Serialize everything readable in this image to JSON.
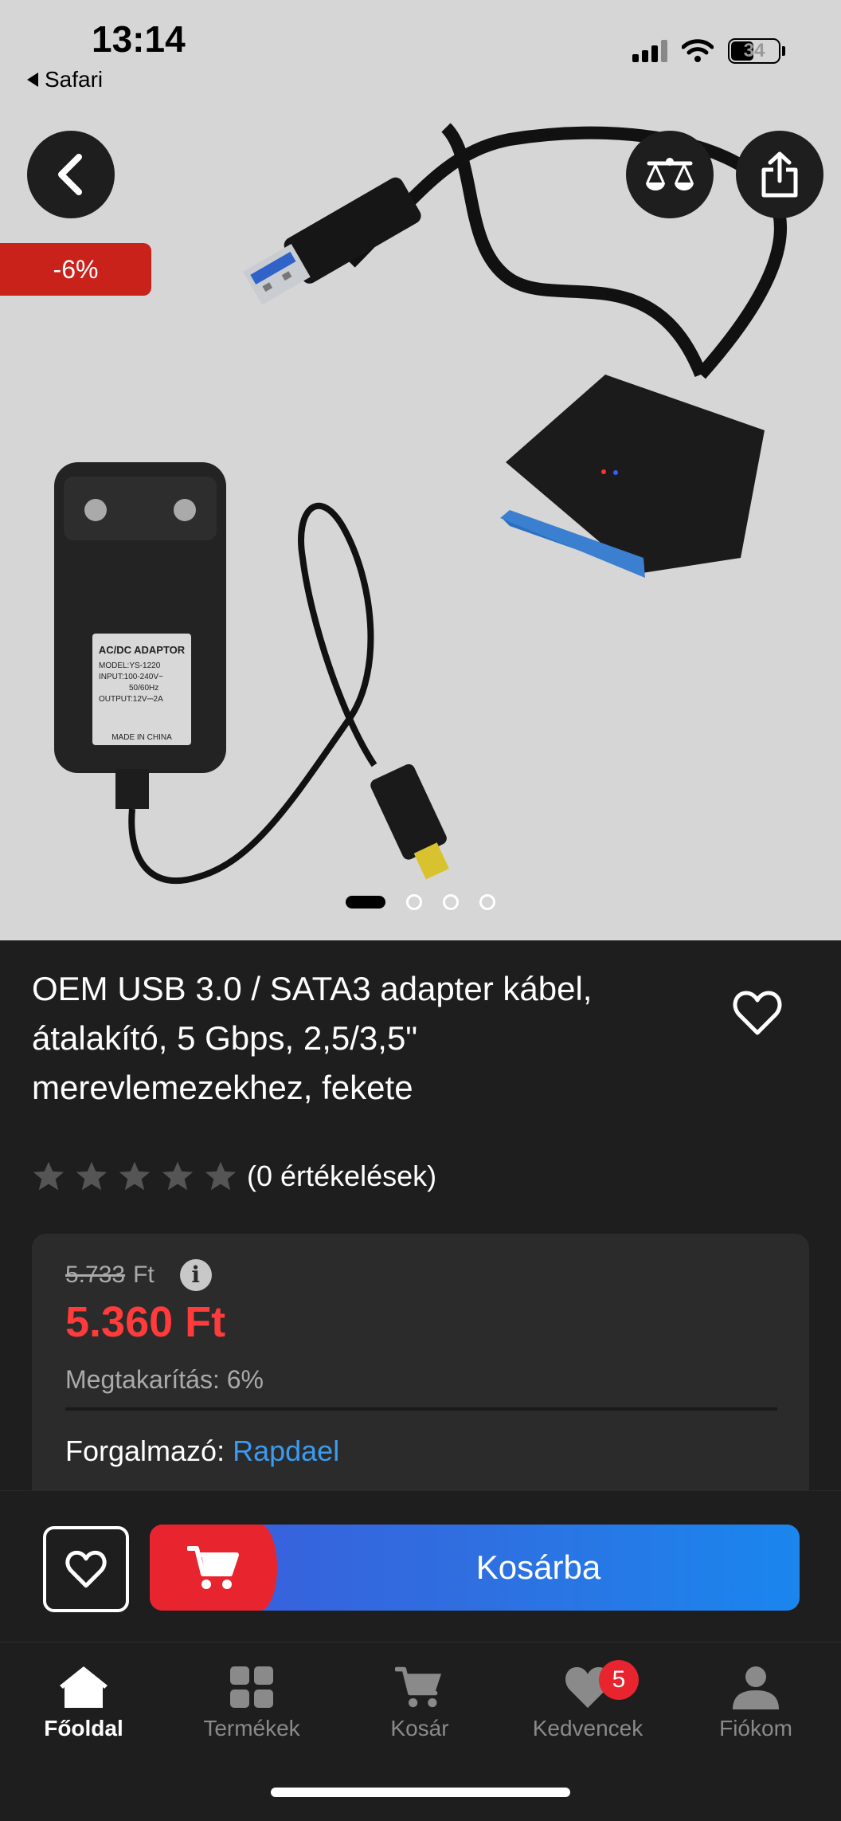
{
  "status_bar": {
    "time": "13:14",
    "back_app": "Safari",
    "battery": "34"
  },
  "product": {
    "discount_badge": "-6%",
    "title": "OEM USB 3.0 / SATA3 adapter kábel, átalakító, 5 Gbps, 2,5/3,5\" merevlemezekhez, fekete",
    "image_count": 4,
    "active_image_index": 0,
    "image_labels": {
      "adaptor_title": "AC/DC ADAPTOR",
      "adaptor_model": "MODEL:YS-1220",
      "adaptor_input": "INPUT:100-240V~",
      "adaptor_hz": "50/60Hz",
      "adaptor_output": "OUTPUT:12V⎓2A",
      "adaptor_origin": "MADE IN CHINA"
    }
  },
  "rating": {
    "stars": 0,
    "max_stars": 5,
    "count_text": "(0 értékelések)"
  },
  "price": {
    "old_value": "5.733",
    "old_currency": "Ft",
    "info_glyph": "i",
    "new_price": "5.360 Ft",
    "savings": "Megtakarítás: 6%",
    "seller_label": "Forgalmazó:",
    "seller_name": "Rapdael"
  },
  "actions": {
    "add_to_cart": "Kosárba"
  },
  "tabs": [
    {
      "label": "Főoldal",
      "icon": "home-icon",
      "active": true
    },
    {
      "label": "Termékek",
      "icon": "grid-icon",
      "active": false
    },
    {
      "label": "Kosár",
      "icon": "cart-icon",
      "active": false
    },
    {
      "label": "Kedvencek",
      "icon": "heart-icon",
      "active": false,
      "badge": "5"
    },
    {
      "label": "Fiókom",
      "icon": "user-icon",
      "active": false
    }
  ],
  "colors": {
    "background": "#1e1e1e",
    "card": "#2b2b2b",
    "sale_red": "#ff3b3b",
    "badge_red": "#c8221a",
    "link_blue": "#3a9bf0",
    "cart_blue": "#2f6fe0"
  }
}
